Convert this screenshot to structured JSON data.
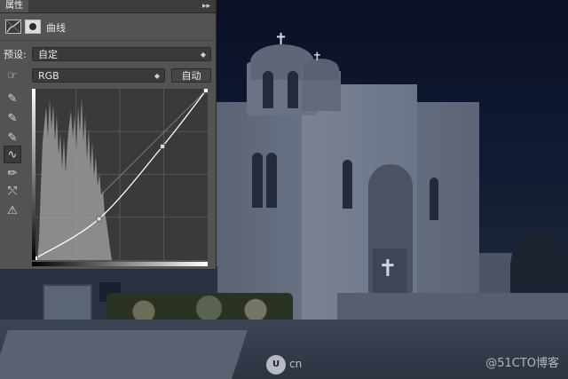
{
  "panel": {
    "tab_title": "属性",
    "tab_menu_glyph": "▸▸",
    "header_title": "曲线",
    "preset_label": "预设:",
    "preset_value": "自定",
    "channel_value": "RGB",
    "auto_button": "自动"
  },
  "tools": [
    {
      "name": "hand-targeted-icon",
      "glyph": "☞"
    },
    {
      "name": "black-point-eyedropper-icon",
      "glyph": "✎"
    },
    {
      "name": "gray-point-eyedropper-icon",
      "glyph": "✎"
    },
    {
      "name": "white-point-eyedropper-icon",
      "glyph": "✎"
    },
    {
      "name": "curve-edit-icon",
      "glyph": "∿"
    },
    {
      "name": "pencil-draw-icon",
      "glyph": "✏"
    },
    {
      "name": "smooth-icon",
      "glyph": "⤲"
    },
    {
      "name": "clipping-warning-icon",
      "glyph": "⚠"
    }
  ],
  "curve": {
    "points": [
      [
        0,
        0
      ],
      [
        95,
        60
      ],
      [
        190,
        170
      ],
      [
        255,
        255
      ]
    ]
  },
  "watermark": {
    "text": "@51CTO博客",
    "logo_letters": "U",
    "logo_suffix": "cn"
  },
  "colors": {
    "panel_bg": "#535353",
    "graph_bg": "#3a3a3a",
    "curve": "#ffffff",
    "histogram": "#9a9a9a"
  }
}
